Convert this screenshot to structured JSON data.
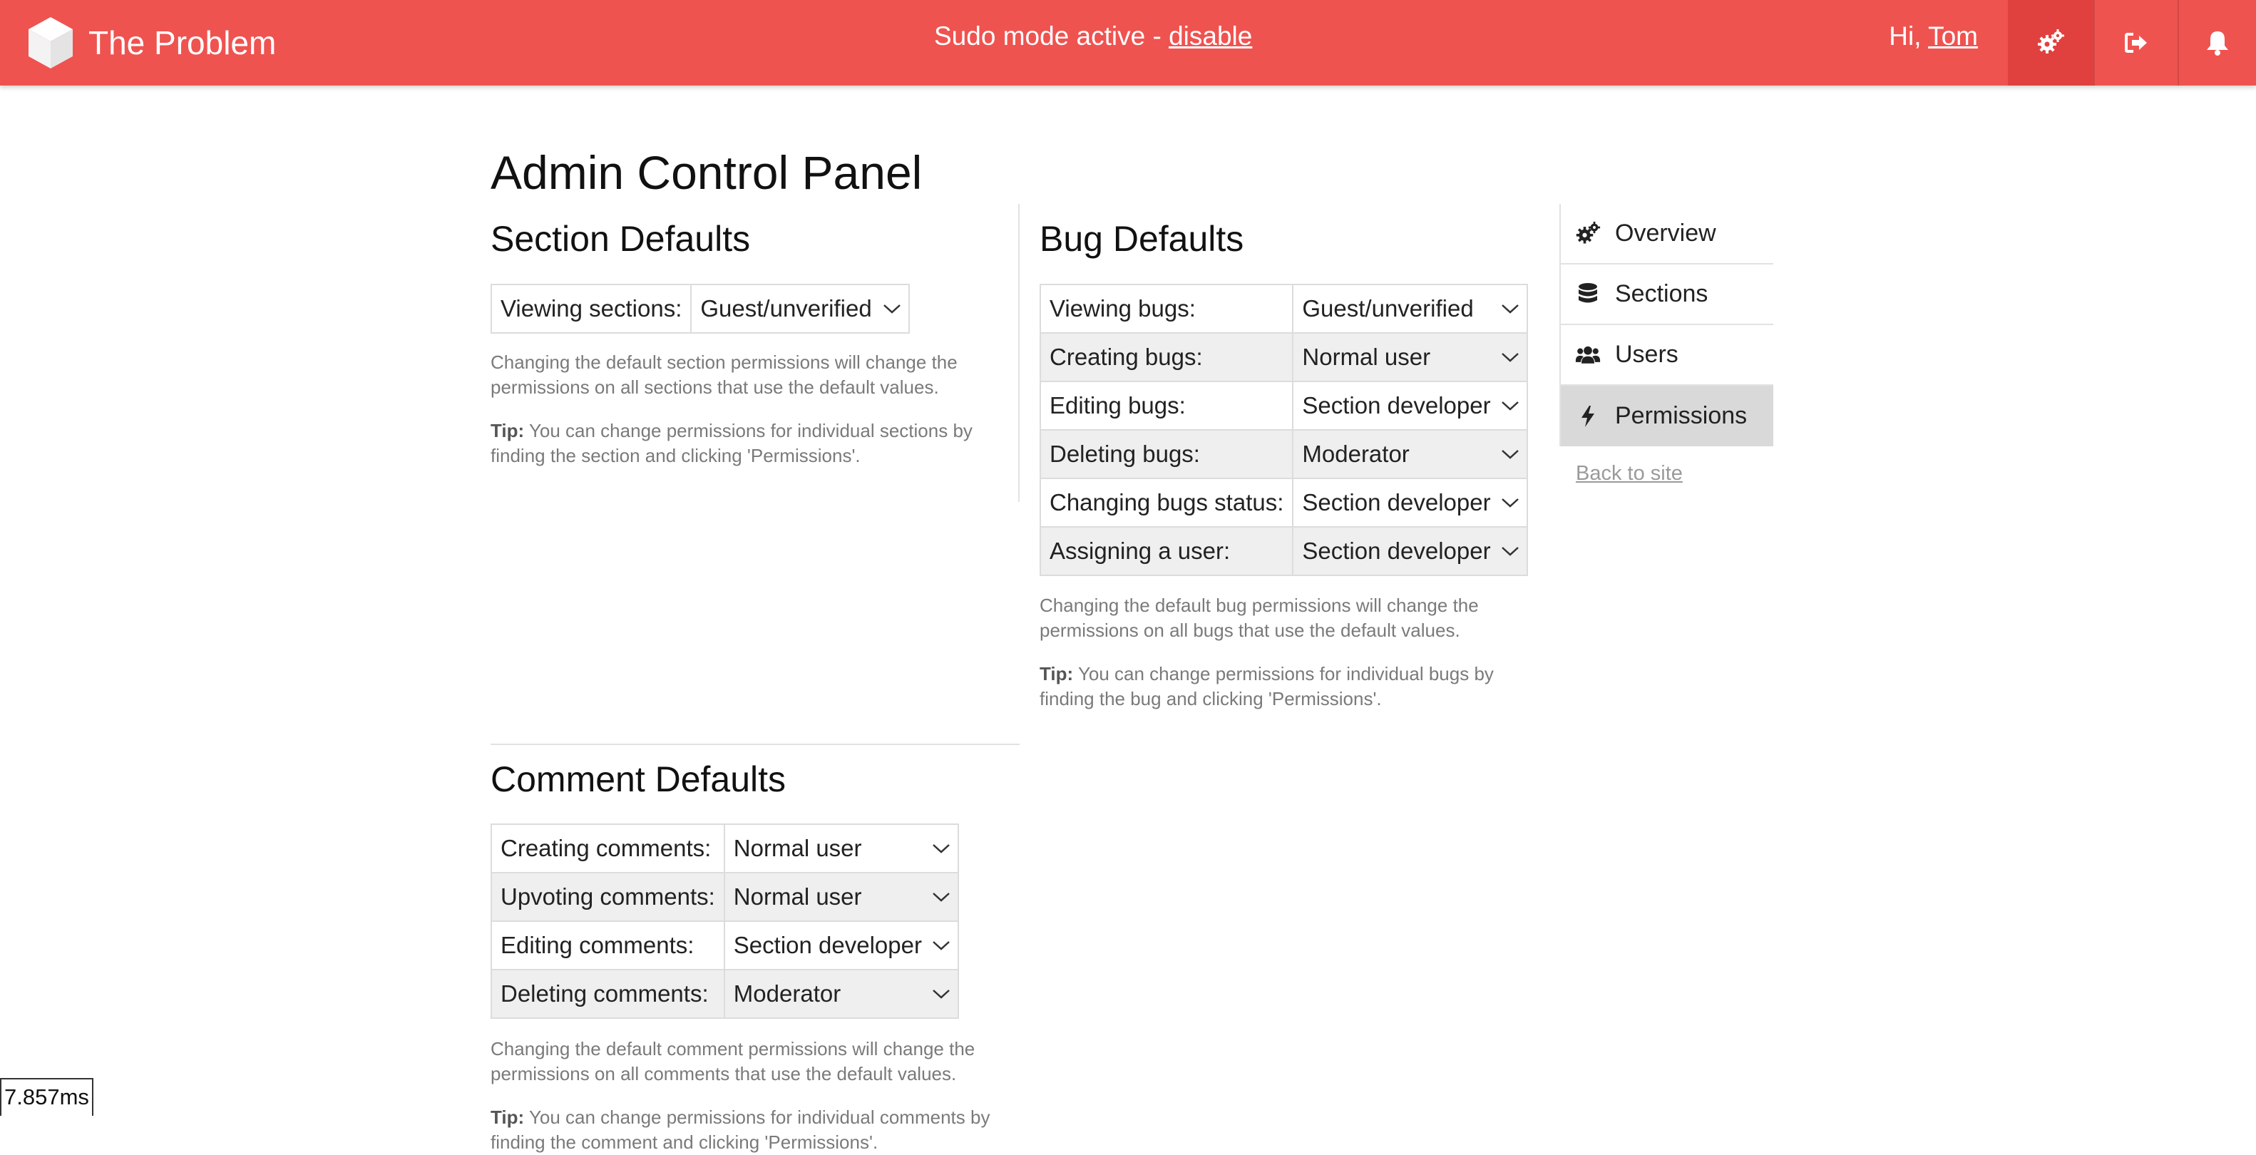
{
  "header": {
    "brand": "The Problem",
    "sudo_text": "Sudo mode active - ",
    "sudo_link": "disable",
    "greeting": "Hi, ",
    "user": "Tom",
    "icons": [
      "cogs-icon",
      "sign-out-icon",
      "bell-icon"
    ],
    "accent_color": "#ef5350"
  },
  "page": {
    "title": "Admin Control Panel"
  },
  "section_defaults": {
    "title": "Section Defaults",
    "rows": [
      {
        "label": "Viewing sections:",
        "value": "Guest/unverified"
      }
    ],
    "help": "Changing the default section permissions will change the permissions on all sections that use the default values.",
    "tip_label": "Tip:",
    "tip": " You can change permissions for individual sections by finding the section and clicking 'Permissions'."
  },
  "bug_defaults": {
    "title": "Bug Defaults",
    "rows": [
      {
        "label": "Viewing bugs:",
        "value": "Guest/unverified"
      },
      {
        "label": "Creating bugs:",
        "value": "Normal user"
      },
      {
        "label": "Editing bugs:",
        "value": "Section developer"
      },
      {
        "label": "Deleting bugs:",
        "value": "Moderator"
      },
      {
        "label": "Changing bugs status:",
        "value": "Section developer"
      },
      {
        "label": "Assigning a user:",
        "value": "Section developer"
      }
    ],
    "help": "Changing the default bug permissions will change the permissions on all bugs that use the default values.",
    "tip_label": "Tip:",
    "tip": " You can change permissions for individual bugs by finding the bug and clicking 'Permissions'."
  },
  "comment_defaults": {
    "title": "Comment Defaults",
    "rows": [
      {
        "label": "Creating comments:",
        "value": "Normal user"
      },
      {
        "label": "Upvoting comments:",
        "value": "Normal user"
      },
      {
        "label": "Editing comments:",
        "value": "Section developer"
      },
      {
        "label": "Deleting comments:",
        "value": "Moderator"
      }
    ],
    "help": "Changing the default comment permissions will change the permissions on all comments that use the default values.",
    "tip_label": "Tip:",
    "tip": " You can change permissions for individual comments by finding the comment and clicking 'Permissions'."
  },
  "sidebar": {
    "items": [
      {
        "label": "Overview",
        "icon": "cogs-icon",
        "active": false
      },
      {
        "label": "Sections",
        "icon": "database-icon",
        "active": false
      },
      {
        "label": "Users",
        "icon": "users-icon",
        "active": false
      },
      {
        "label": "Permissions",
        "icon": "bolt-icon",
        "active": true
      }
    ],
    "back_link": "Back to site"
  },
  "footer": {
    "timer": "7.857ms"
  }
}
